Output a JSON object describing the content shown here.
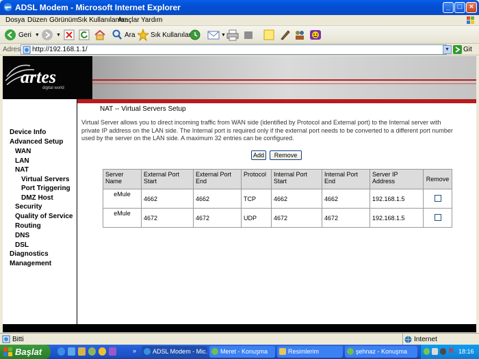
{
  "window": {
    "title": "ADSL Modem - Microsoft Internet Explorer"
  },
  "menu": [
    "Dosya",
    "Düzen",
    "Görünüm",
    "Sık Kullanılanlar",
    "Araçlar",
    "Yardım"
  ],
  "toolbar": {
    "back": "Geri",
    "search": "Ara",
    "favorites": "Sık Kullanılanlar"
  },
  "address": {
    "label": "Adres",
    "url": "http://192.168.1.1/",
    "go": "Git"
  },
  "brand": {
    "name": "artes",
    "tagline": "digital world"
  },
  "nav": [
    {
      "label": "Device Info",
      "level": 0
    },
    {
      "label": "Advanced Setup",
      "level": 0
    },
    {
      "label": "WAN",
      "level": 1
    },
    {
      "label": "LAN",
      "level": 1
    },
    {
      "label": "NAT",
      "level": 1
    },
    {
      "label": "Virtual Servers",
      "level": 2
    },
    {
      "label": "Port Triggering",
      "level": 2
    },
    {
      "label": "DMZ Host",
      "level": 2
    },
    {
      "label": "Security",
      "level": 1
    },
    {
      "label": "Quality of Service",
      "level": 1
    },
    {
      "label": "Routing",
      "level": 1
    },
    {
      "label": "DNS",
      "level": 1
    },
    {
      "label": "DSL",
      "level": 1
    },
    {
      "label": "Diagnostics",
      "level": 0
    },
    {
      "label": "Management",
      "level": 0
    }
  ],
  "page": {
    "title": "NAT -- Virtual Servers Setup",
    "description": "Virtual Server allows you to direct incoming traffic from WAN side (identified by Protocol and External port) to the Internal server with private IP address on the LAN side. The Internal port is required only if the external port needs to be converted to a different port number used by the server on the LAN side. A maximum 32 entries can be configured.",
    "add_label": "Add",
    "remove_label": "Remove"
  },
  "table": {
    "headers": [
      "Server Name",
      "External Port Start",
      "External Port End",
      "Protocol",
      "Internal Port Start",
      "Internal Port End",
      "Server IP Address",
      "Remove"
    ],
    "rows": [
      [
        "eMule",
        "4662",
        "4662",
        "TCP",
        "4662",
        "4662",
        "192.168.1.5"
      ],
      [
        "eMule",
        "4672",
        "4672",
        "UDP",
        "4672",
        "4672",
        "192.168.1.5"
      ]
    ]
  },
  "status": {
    "text": "Bitti",
    "zone": "Internet"
  },
  "taskbar": {
    "start": "Başlat",
    "tasks": [
      "ADSL Modem - Mic...",
      "Meret - Konuşma",
      "Resimlerim",
      "şehnaz - Konuşma"
    ],
    "clock": "18:16"
  },
  "colors": {
    "accent_red": "#b51d1d",
    "xp_blue": "#0a5ee8",
    "start_green": "#2f8a2f"
  }
}
